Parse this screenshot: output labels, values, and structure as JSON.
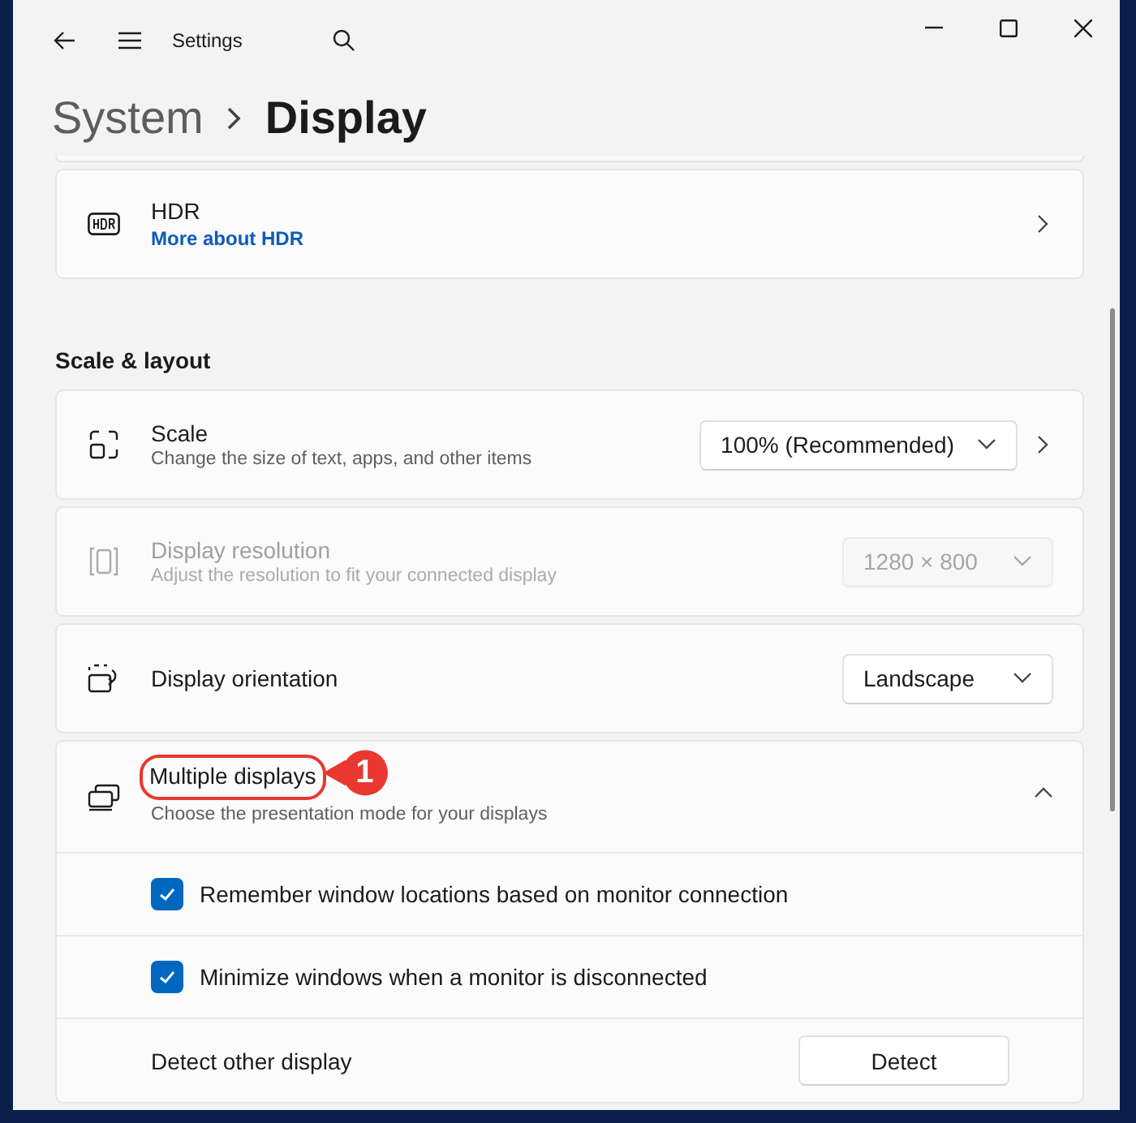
{
  "window": {
    "title": "Settings"
  },
  "breadcrumb": [
    {
      "label": "System",
      "current": false
    },
    {
      "label": "Display",
      "current": true
    }
  ],
  "cards_top": [
    {
      "kind": "nav",
      "title": "HDR",
      "link": "More about HDR"
    }
  ],
  "section": {
    "title": "Scale & layout"
  },
  "cards": [
    {
      "kind": "select",
      "title": "Scale",
      "subtitle": "Change the size of text, apps, and other items",
      "value": "100% (Recommended)",
      "chevron": true,
      "disabled": false
    },
    {
      "kind": "select",
      "title": "Display resolution",
      "subtitle": "Adjust the resolution to fit your connected display",
      "value": "1280 × 800",
      "chevron": false,
      "disabled": true
    },
    {
      "kind": "select",
      "title": "Display orientation",
      "value": "Landscape",
      "chevron": false,
      "disabled": false
    },
    {
      "kind": "expander",
      "title": "Multiple displays",
      "subtitle": "Choose the presentation mode for your displays",
      "expanded": true,
      "callout": "1",
      "children": [
        {
          "kind": "checkbox",
          "label": "Remember window locations based on monitor connection",
          "checked": true
        },
        {
          "kind": "checkbox",
          "label": "Minimize windows when a monitor is disconnected",
          "checked": true
        },
        {
          "kind": "button",
          "label": "Detect other display",
          "button": "Detect"
        }
      ]
    }
  ]
}
